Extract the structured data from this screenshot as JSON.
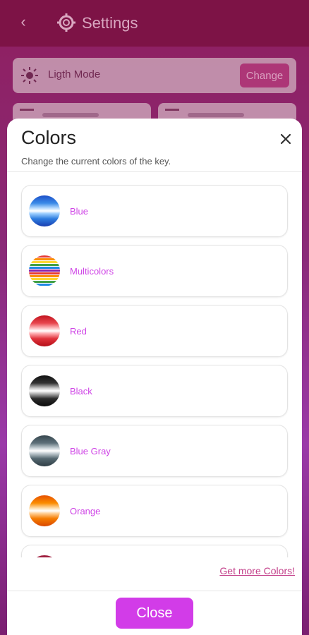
{
  "background": {
    "header_title": "Settings",
    "mode_label": "Ligth Mode",
    "change_label": "Change"
  },
  "modal": {
    "title": "Colors",
    "subtitle": "Change the current colors of the key.",
    "more_link": "Get more Colors!",
    "close_label": "Close"
  },
  "colors": [
    {
      "label": "Blue",
      "icon": "blue-swatch-icon"
    },
    {
      "label": "Multicolors",
      "icon": "multicolor-swatch-icon"
    },
    {
      "label": "Red",
      "icon": "red-swatch-icon"
    },
    {
      "label": "Black",
      "icon": "black-swatch-icon"
    },
    {
      "label": "Blue Gray",
      "icon": "blue-gray-swatch-icon"
    },
    {
      "label": "Orange",
      "icon": "orange-swatch-icon"
    }
  ],
  "accent_color": "#d23ce8",
  "label_color": "#cf45e6",
  "link_color": "#c3408a"
}
